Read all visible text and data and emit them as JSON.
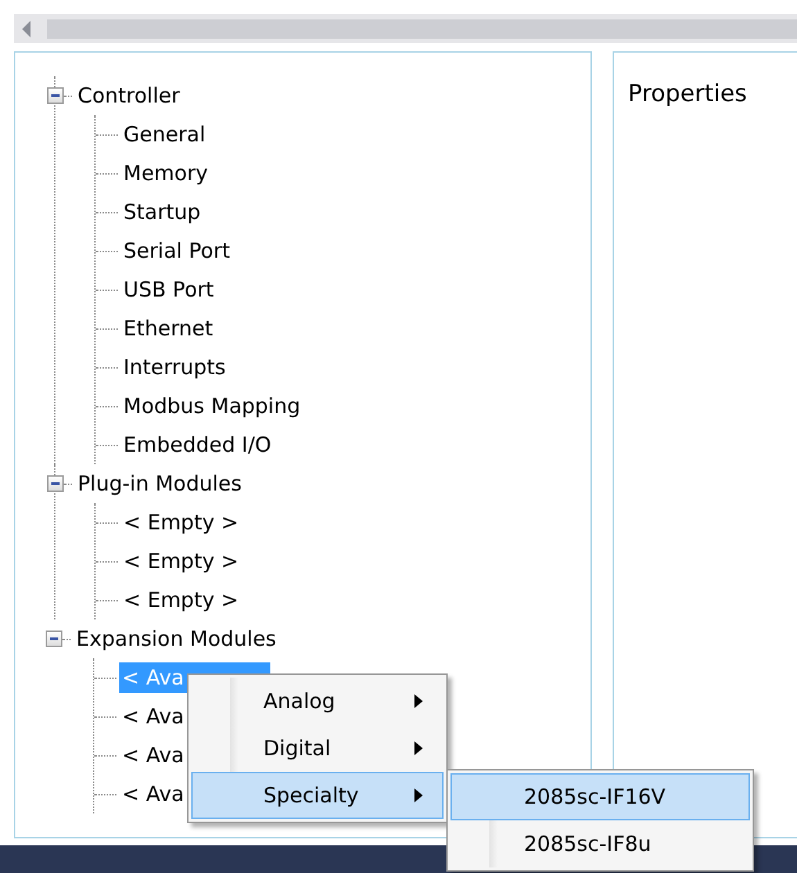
{
  "tree": [
    {
      "label": "Controller",
      "expanded": true,
      "selected": false,
      "children": [
        {
          "label": "General",
          "selected": false
        },
        {
          "label": "Memory",
          "selected": false
        },
        {
          "label": "Startup",
          "selected": false
        },
        {
          "label": "Serial Port",
          "selected": false
        },
        {
          "label": "USB Port",
          "selected": false
        },
        {
          "label": "Ethernet",
          "selected": false
        },
        {
          "label": "Interrupts",
          "selected": false
        },
        {
          "label": "Modbus Mapping",
          "selected": false
        },
        {
          "label": "Embedded I/O",
          "selected": false
        }
      ]
    },
    {
      "label": "Plug-in Modules",
      "expanded": true,
      "selected": false,
      "children": [
        {
          "label": "< Empty >",
          "selected": false
        },
        {
          "label": "< Empty >",
          "selected": false
        },
        {
          "label": "< Empty >",
          "selected": false
        }
      ]
    },
    {
      "label": "Expansion Modules",
      "expanded": true,
      "selected": false,
      "children": [
        {
          "label": "< Ava",
          "selected": true
        },
        {
          "label": "< Ava",
          "selected": false
        },
        {
          "label": "< Ava",
          "selected": false
        },
        {
          "label": "< Ava",
          "selected": false
        }
      ]
    }
  ],
  "properties_panel": {
    "title": "Properties"
  },
  "context_menu": {
    "items": [
      {
        "label": "Analog",
        "selected": false
      },
      {
        "label": "Digital",
        "selected": false
      },
      {
        "label": "Specialty",
        "selected": true
      }
    ]
  },
  "submenu": {
    "items": [
      {
        "label": "2085sc-IF16V",
        "selected": true
      },
      {
        "label": "2085sc-IF8u",
        "selected": false
      }
    ]
  }
}
